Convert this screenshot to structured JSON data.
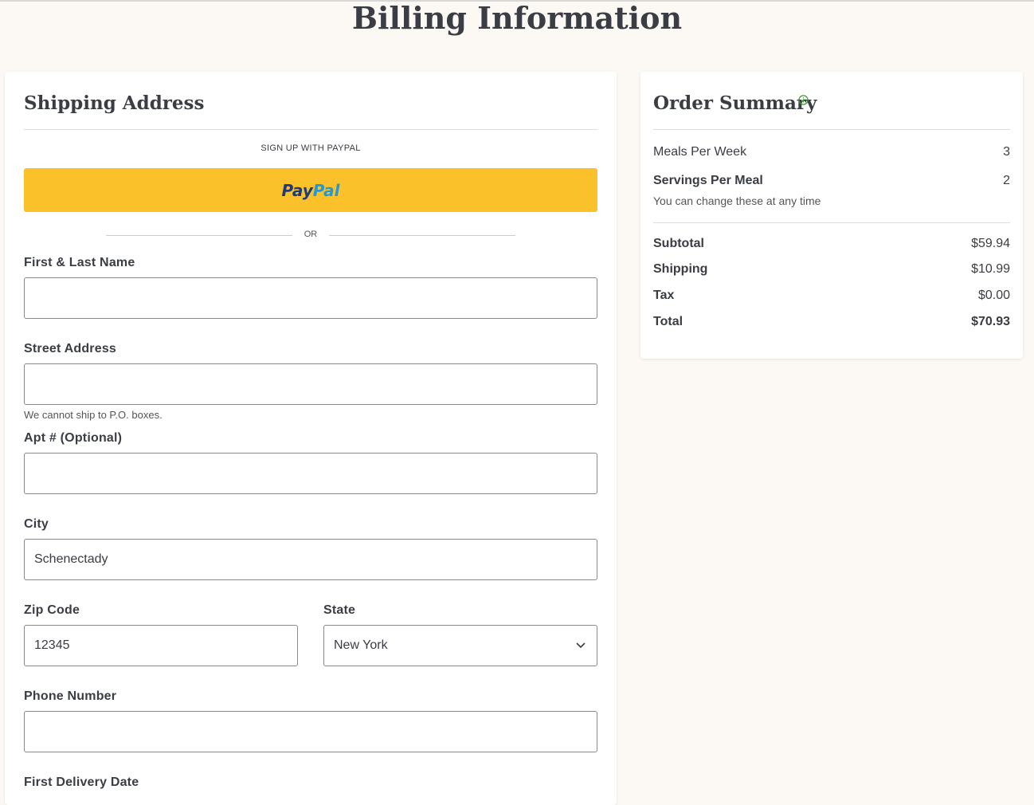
{
  "page": {
    "title": "Billing Information"
  },
  "shipping": {
    "heading": "Shipping Address",
    "paypal_caption": "SIGN UP WITH PAYPAL",
    "paypal_logo_pay": "Pay",
    "paypal_logo_pal": "Pal",
    "or_text": "OR",
    "fields": {
      "name": {
        "label": "First & Last Name",
        "value": ""
      },
      "street": {
        "label": "Street Address",
        "value": "",
        "hint": "We cannot ship to P.O. boxes."
      },
      "apt": {
        "label": "Apt # (Optional)",
        "value": ""
      },
      "city": {
        "label": "City",
        "value": "Schenectady"
      },
      "zip": {
        "label": "Zip Code",
        "value": "12345"
      },
      "state": {
        "label": "State",
        "selected": "New York"
      },
      "phone": {
        "label": "Phone Number",
        "value": ""
      },
      "delivery": {
        "label": "First Delivery Date"
      }
    }
  },
  "summary": {
    "heading": "Order Summary",
    "meals_per_week": {
      "label": "Meals Per Week",
      "value": "3"
    },
    "servings_per_meal": {
      "label": "Servings Per Meal",
      "value": "2"
    },
    "change_note": "You can change these at any time",
    "subtotal": {
      "label": "Subtotal",
      "value": "$59.94"
    },
    "shipping": {
      "label": "Shipping",
      "value": "$10.99"
    },
    "tax": {
      "label": "Tax",
      "value": "$0.00"
    },
    "total": {
      "label": "Total",
      "value": "$70.93"
    }
  },
  "colors": {
    "paypal_yellow": "#fbc12a",
    "info_green": "#3a9a2e"
  },
  "icons": {
    "info": "info-icon",
    "select": "chevron-down-icon"
  }
}
